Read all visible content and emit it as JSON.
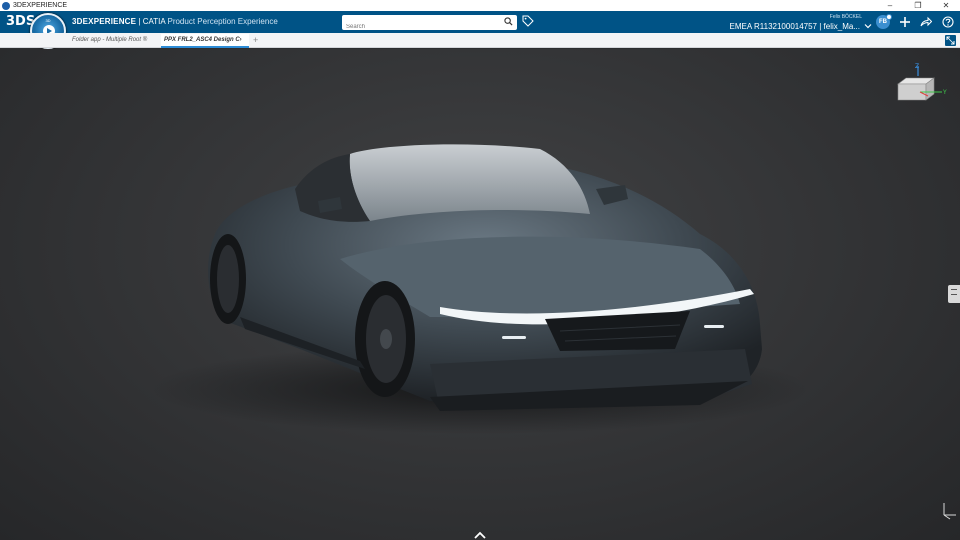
{
  "os": {
    "title": "3DEXPERIENCE",
    "minimize": "–",
    "maximize": "❐",
    "close": "✕"
  },
  "topbar": {
    "logo": "3DS",
    "brand_bold": "3DEXPERIENCE",
    "brand_sep": " | CATIA ",
    "brand_app": "Product Perception Experience",
    "search_placeholder": "Search",
    "user_name": "Felix BÖCKEL",
    "tenant": "EMEA R1132100014757 | felix_Ma...",
    "avatar_initials": "FB"
  },
  "compass": {
    "top_label": "3D",
    "bottom_label": "V,R"
  },
  "tabs": {
    "breadcrumb": "Folder app - Multiple Root ®",
    "active": "PPX FRL2_ASC4 Design C›",
    "add": "+"
  },
  "cube": {
    "z": "Z",
    "y": "Y"
  },
  "colors": {
    "accent": "#005386",
    "viewport_bg": "#323335",
    "tab_underline": "#2d8cd6"
  },
  "icons": [
    "search-icon",
    "tag-icon",
    "chevron-down-icon",
    "add-icon",
    "share-icon",
    "help-icon",
    "fullscreen-icon",
    "view-cube-icon",
    "axis-triad-icon",
    "chevron-up-icon"
  ]
}
